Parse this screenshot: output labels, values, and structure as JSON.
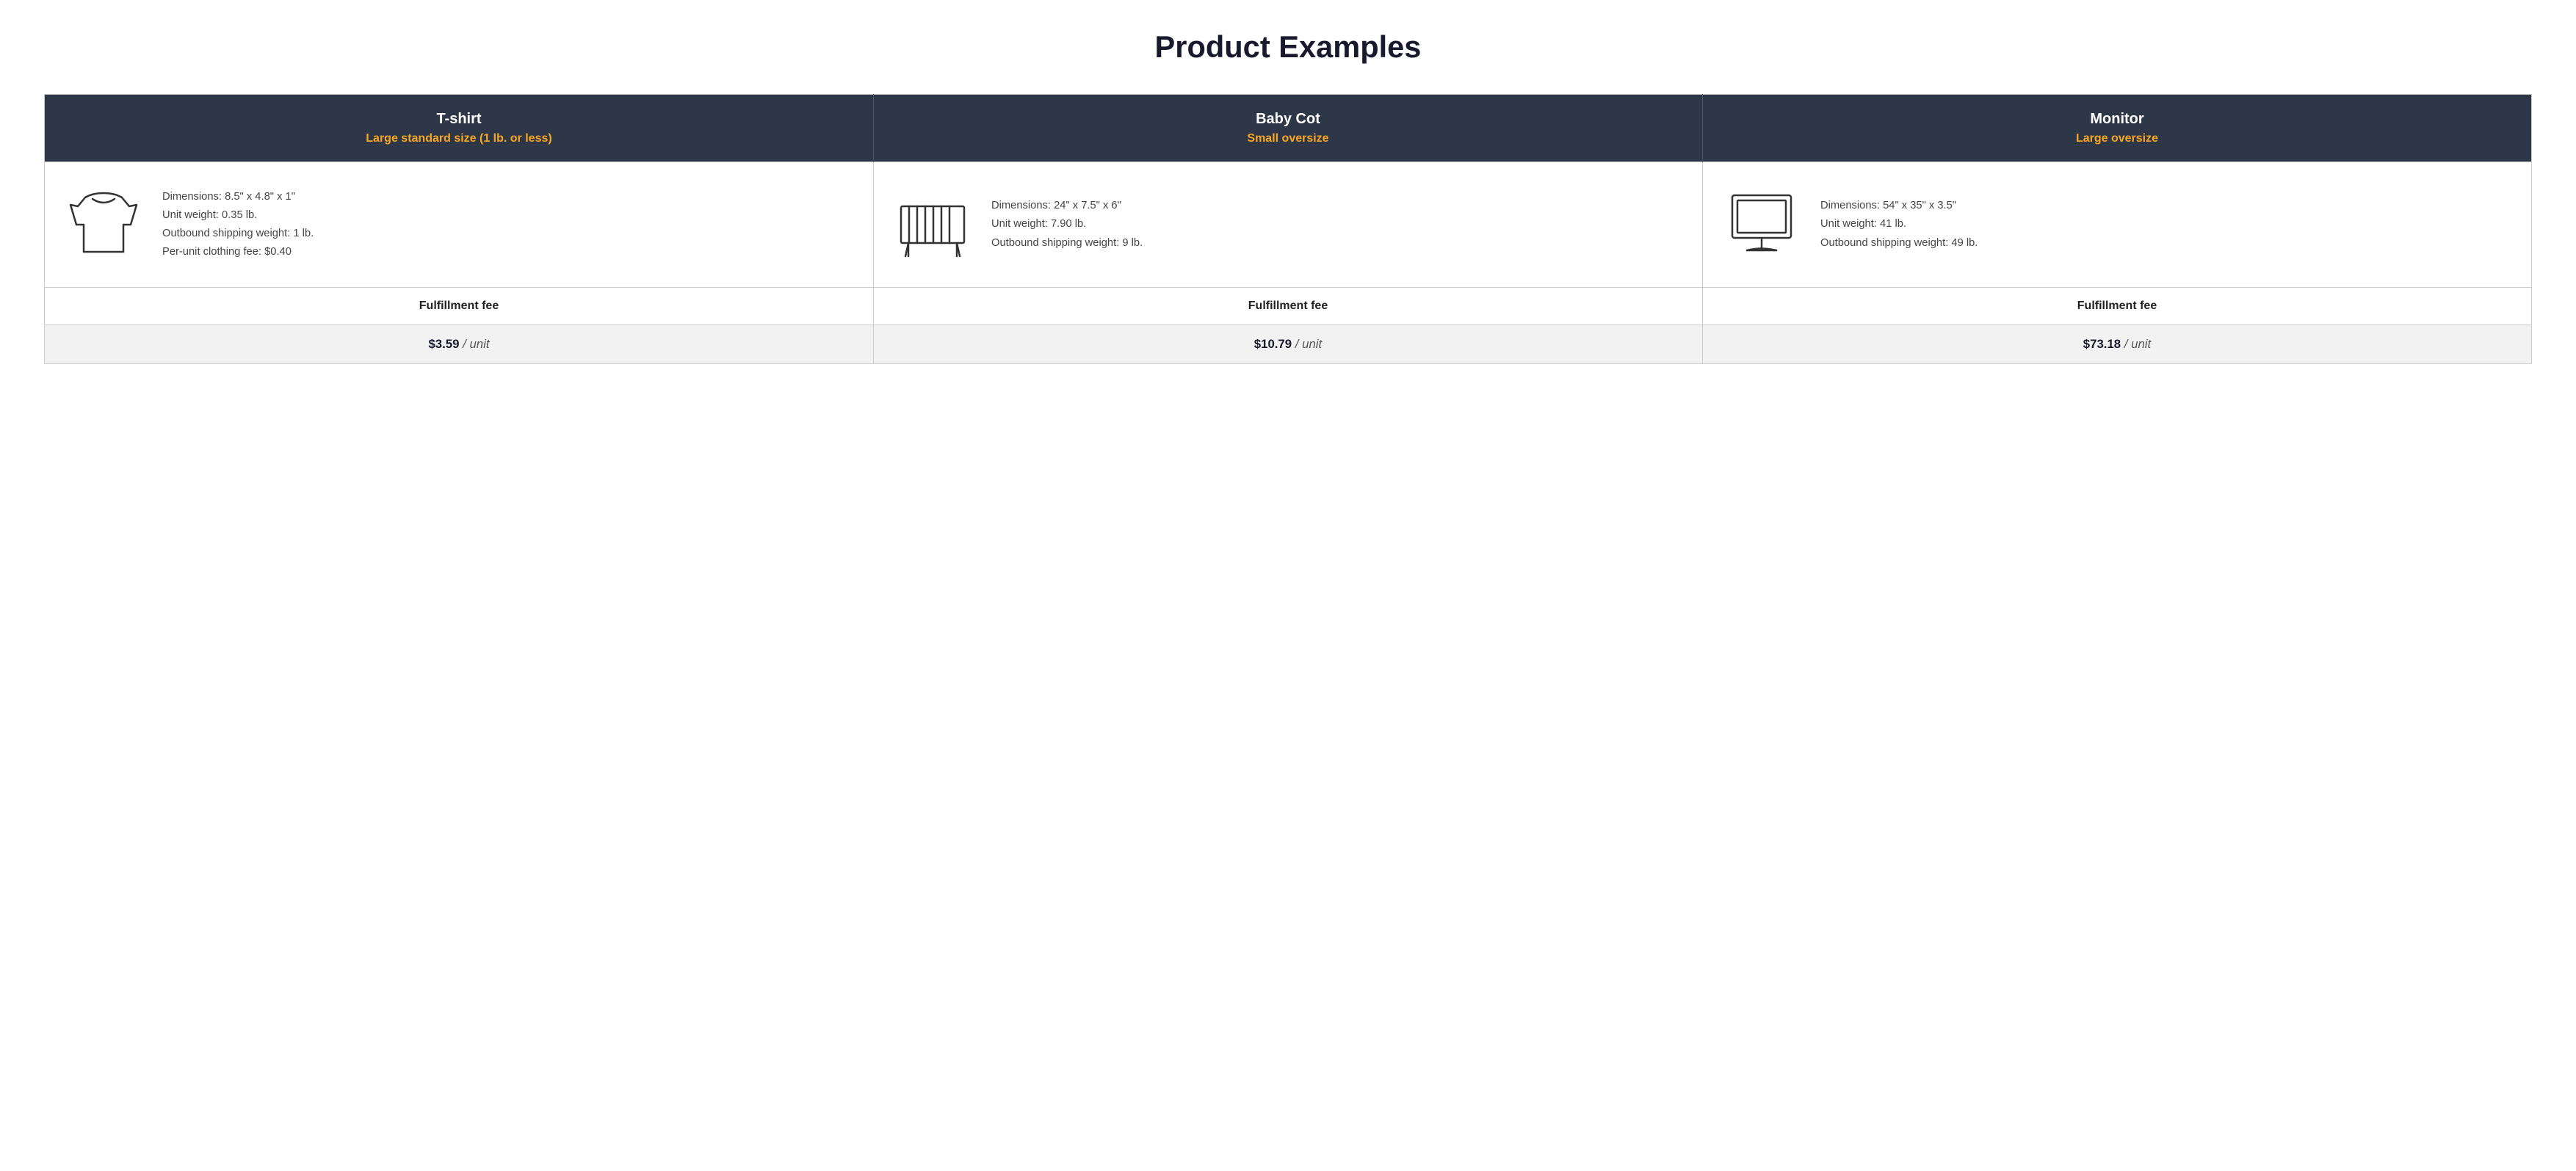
{
  "page": {
    "title": "Product Examples"
  },
  "columns": [
    {
      "id": "tshirt",
      "name": "T-shirt",
      "size_label": "Large standard size (1 lb. or less)",
      "dimensions": "Dimensions: 8.5\" x 4.8\" x 1\"",
      "unit_weight": "Unit weight: 0.35 lb.",
      "outbound_shipping": "Outbound shipping weight: 1 lb.",
      "extra_fee": "Per-unit clothing fee: $0.40",
      "fulfillment_label": "Fulfillment fee",
      "fee_amount": "$3.59",
      "fee_unit": "/ unit",
      "icon": "tshirt"
    },
    {
      "id": "babycot",
      "name": "Baby Cot",
      "size_label": "Small oversize",
      "dimensions": "Dimensions: 24\" x 7.5\" x 6\"",
      "unit_weight": "Unit weight: 7.90 lb.",
      "outbound_shipping": "Outbound shipping weight: 9 lb.",
      "extra_fee": "",
      "fulfillment_label": "Fulfillment fee",
      "fee_amount": "$10.79",
      "fee_unit": "/ unit",
      "icon": "cot"
    },
    {
      "id": "monitor",
      "name": "Monitor",
      "size_label": "Large oversize",
      "dimensions": "Dimensions: 54\" x 35\" x 3.5\"",
      "unit_weight": "Unit weight: 41 lb.",
      "outbound_shipping": "Outbound shipping weight: 49 lb.",
      "extra_fee": "",
      "fulfillment_label": "Fulfillment fee",
      "fee_amount": "$73.18",
      "fee_unit": "/ unit",
      "icon": "monitor"
    }
  ]
}
